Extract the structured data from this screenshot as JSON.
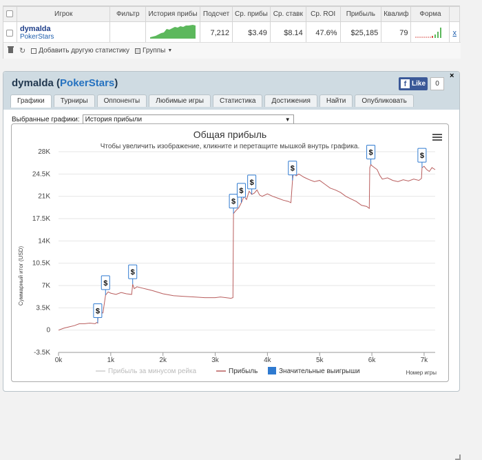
{
  "table": {
    "headers": [
      "",
      "Игрок",
      "Фильтр",
      "История прибы",
      "Подсчет",
      "Ср. прибы",
      "Ср. ставк",
      "Ср. ROI",
      "Прибыль",
      "Квалиф",
      "Форма",
      ""
    ],
    "row": {
      "player": "dymalda",
      "room": "PokerStars",
      "count": "7,212",
      "avg_profit": "$3.49",
      "avg_stake": "$8.14",
      "avg_roi": "47.6%",
      "profit": "$25,185",
      "qualif": "79",
      "remove": "x"
    }
  },
  "toolbar": {
    "add_stat": "Добавить другую статистику",
    "groups": "Группы"
  },
  "panel": {
    "player": "dymalda",
    "room": "PokerStars",
    "fb_like": "Like",
    "fb_count": "0",
    "close": "×",
    "tabs": [
      "Графики",
      "Турниры",
      "Оппоненты",
      "Любимые игры",
      "Статистика",
      "Достижения",
      "Найти",
      "Опубликовать"
    ],
    "select_label": "Выбранные графики:",
    "select_value": "История прибыли"
  },
  "colors": {
    "profit_line": "#b85c5c",
    "rake_line": "#cccccc",
    "big_win": "#2f7ad0",
    "fill_green": "#5cb85c"
  },
  "chart_data": {
    "type": "line",
    "title": "Общая прибыль",
    "subtitle": "Чтобы увеличить изображение, кликните и перетащите мышкой внутрь графика.",
    "ylabel": "Суммарный итог (USD)",
    "xlabel": "Номер игры",
    "ylim": [
      -3500,
      28000
    ],
    "xlim": [
      0,
      7212
    ],
    "y_ticks": [
      "-3.5K",
      "0",
      "3.5K",
      "7K",
      "10.5K",
      "14K",
      "17.5K",
      "21K",
      "24.5K",
      "28K"
    ],
    "y_tick_values": [
      -3500,
      0,
      3500,
      7000,
      10500,
      14000,
      17500,
      21000,
      24500,
      28000
    ],
    "x_ticks": [
      "0k",
      "1k",
      "2k",
      "3k",
      "4k",
      "5k",
      "6k",
      "7k"
    ],
    "x_tick_values": [
      0,
      1000,
      2000,
      3000,
      4000,
      5000,
      6000,
      7000
    ],
    "legend": [
      "Прибыль за минусом рейка",
      "Прибыль",
      "Значительные выигрыши"
    ],
    "series": [
      {
        "name": "Прибыль",
        "x": [
          0,
          100,
          200,
          300,
          400,
          500,
          600,
          700,
          730,
          750,
          760,
          800,
          850,
          900,
          950,
          1000,
          1100,
          1200,
          1300,
          1400,
          1420,
          1450,
          1500,
          1600,
          1700,
          1800,
          2000,
          2200,
          2400,
          2600,
          2800,
          3000,
          3100,
          3300,
          3340,
          3350,
          3400,
          3450,
          3500,
          3550,
          3600,
          3650,
          3700,
          3750,
          3800,
          3850,
          3900,
          4000,
          4100,
          4200,
          4300,
          4400,
          4450,
          4480,
          4500,
          4550,
          4600,
          4700,
          4800,
          4900,
          5000,
          5100,
          5200,
          5300,
          5400,
          5500,
          5600,
          5700,
          5800,
          5900,
          5950,
          5960,
          5980,
          6000,
          6050,
          6100,
          6150,
          6200,
          6300,
          6400,
          6500,
          6600,
          6700,
          6800,
          6900,
          6950,
          6960,
          7000,
          7050,
          7100,
          7150,
          7212
        ],
        "y": [
          0,
          300,
          500,
          700,
          1000,
          1000,
          1100,
          1000,
          1200,
          1100,
          2700,
          2700,
          2700,
          5500,
          6000,
          5800,
          5600,
          5900,
          5700,
          5600,
          7200,
          6500,
          6800,
          6600,
          6400,
          6200,
          5700,
          5400,
          5300,
          5200,
          5100,
          5100,
          5200,
          5000,
          5100,
          18300,
          18800,
          19200,
          20000,
          21000,
          20500,
          21800,
          21300,
          21500,
          22000,
          21200,
          21000,
          21400,
          21000,
          20700,
          20400,
          20200,
          20000,
          23500,
          24800,
          24200,
          24500,
          24000,
          23600,
          23300,
          23500,
          22900,
          22300,
          22000,
          21600,
          21000,
          20600,
          20200,
          19600,
          19400,
          19100,
          25500,
          26000,
          25800,
          25500,
          25200,
          24300,
          23700,
          23900,
          23500,
          23300,
          23600,
          23400,
          23700,
          23500,
          23800,
          25500,
          25700,
          25200,
          24900,
          25500,
          25185
        ]
      }
    ],
    "big_wins_x": [
      750,
      900,
      1420,
      3350,
      3500,
      3700,
      4480,
      5980,
      6960
    ]
  }
}
